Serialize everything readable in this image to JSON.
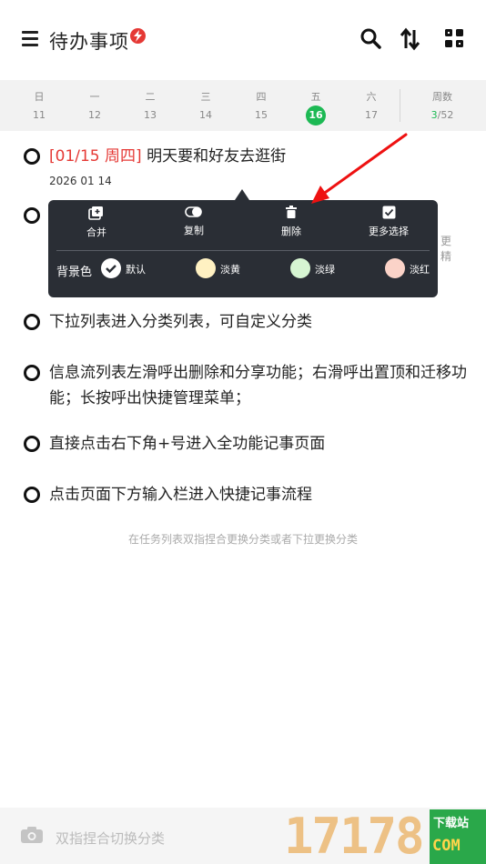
{
  "header": {
    "title": "待办事项"
  },
  "week": {
    "days": [
      {
        "name": "日",
        "date": "11"
      },
      {
        "name": "一",
        "date": "12"
      },
      {
        "name": "二",
        "date": "13"
      },
      {
        "name": "三",
        "date": "14"
      },
      {
        "name": "四",
        "date": "15"
      },
      {
        "name": "五",
        "date": "16"
      },
      {
        "name": "六",
        "date": "17"
      }
    ],
    "today_index": 5,
    "weeknum_label": "周数",
    "weeknum_current": "3",
    "weeknum_total": "/52"
  },
  "tasks": [
    {
      "date_tag": "[01/15 周四]",
      "text": "明天要和好友去逛街",
      "sub": "2026 01 14"
    },
    {
      "text": ""
    },
    {
      "text": "下拉列表进入分类列表，可自定义分类"
    },
    {
      "text": "信息流列表左滑呼出删除和分享功能；右滑呼出置顶和迁移功能；长按呼出快捷管理菜单；"
    },
    {
      "text": "直接点击右下角+号进入全功能记事页面"
    },
    {
      "text": "点击页面下方输入栏进入快捷记事流程"
    }
  ],
  "side_text": {
    "a": "更",
    "b": "精"
  },
  "hint": "在任务列表双指捏合更换分类或者下拉更换分类",
  "popup": {
    "actions": [
      {
        "label": "合并",
        "icon": "merge-icon"
      },
      {
        "label": "复制",
        "icon": "copy-icon"
      },
      {
        "label": "删除",
        "icon": "trash-icon"
      },
      {
        "label": "更多选择",
        "icon": "checkbox-icon"
      }
    ],
    "bg_label": "背景色",
    "colors": [
      {
        "label": "默认",
        "color": "#ffffff"
      },
      {
        "label": "淡黄",
        "color": "#fff1c2"
      },
      {
        "label": "淡绿",
        "color": "#d6f5d2"
      },
      {
        "label": "淡红",
        "color": "#fbd3c8"
      }
    ]
  },
  "bottom": {
    "placeholder": "双指捏合切换分类"
  },
  "watermark": {
    "number": "17178",
    "line1": "下载站",
    "line2": "COM"
  },
  "colors": {
    "accent_green": "#1db954",
    "date_red": "#e53935",
    "popup_bg": "#2a2e35"
  }
}
